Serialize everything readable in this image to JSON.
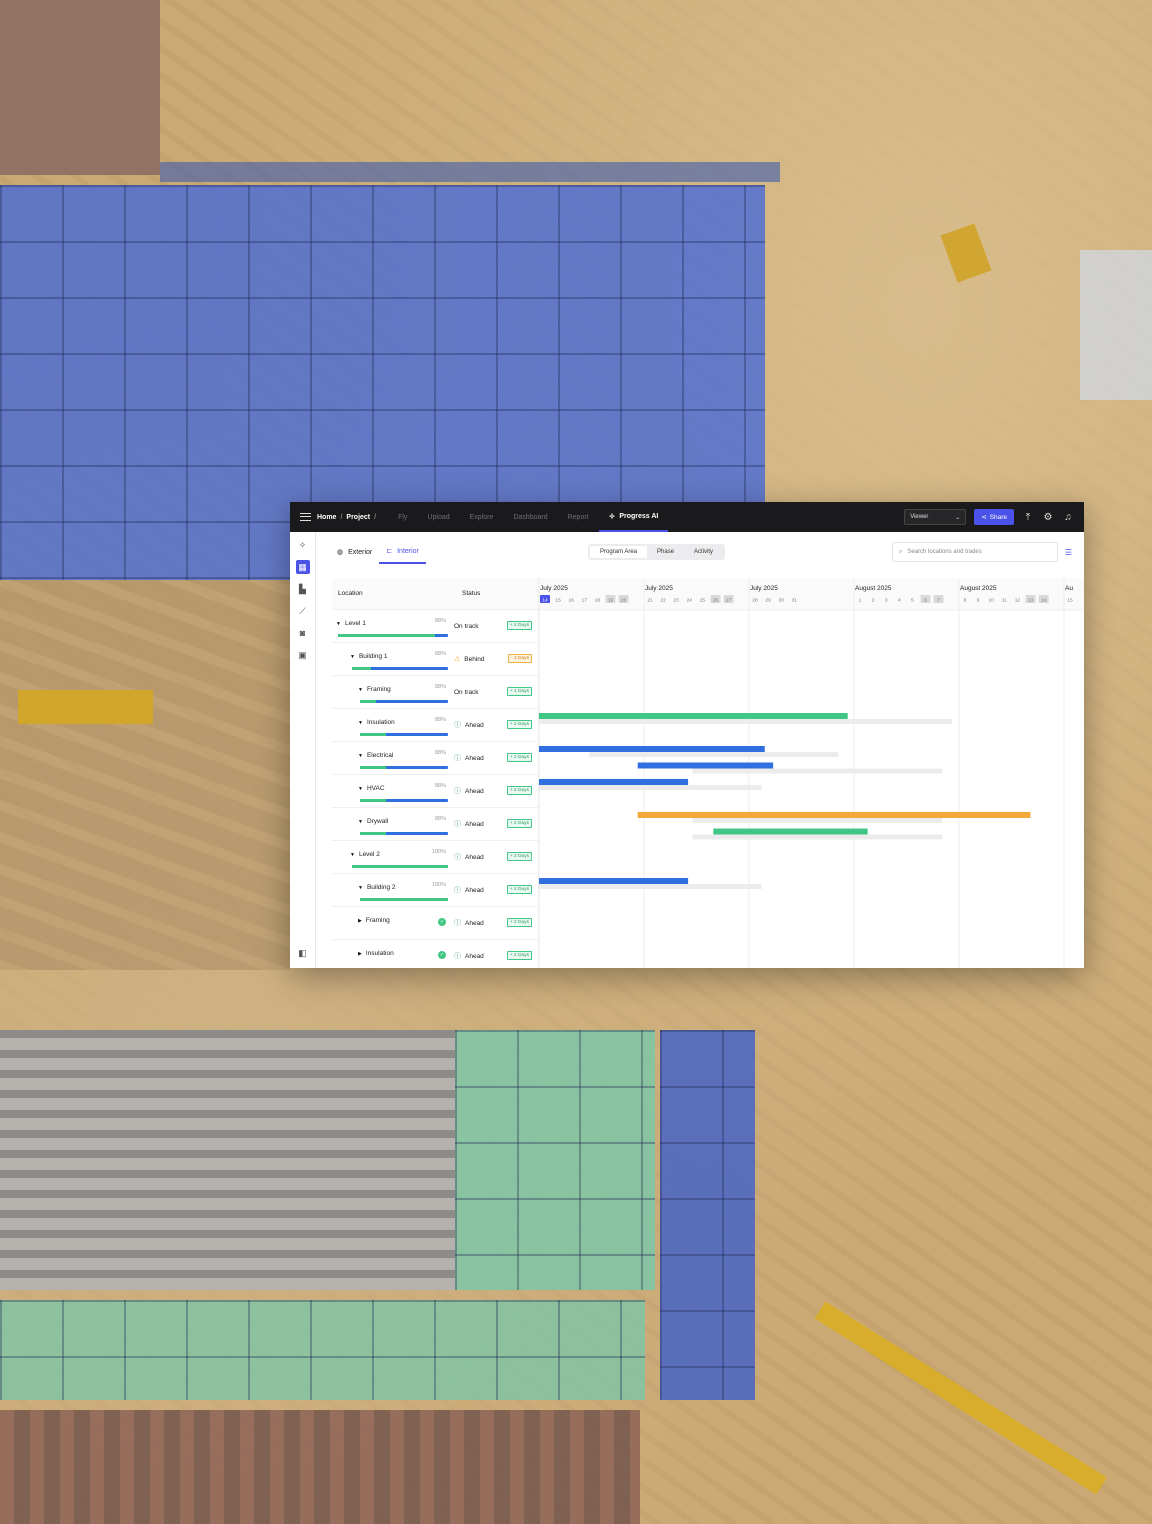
{
  "header": {
    "breadcrumb": [
      "Home",
      "Project"
    ],
    "nav": [
      "Fly",
      "Upload",
      "Explore",
      "Dashboard",
      "Report",
      "Progress AI"
    ],
    "active_nav": "Progress AI",
    "viewer_select": "Viewer",
    "share_label": "Share",
    "icons": [
      "menu-icon",
      "upload-icon",
      "settings-icon",
      "bell-icon"
    ]
  },
  "sidebar": {
    "icons": [
      "sparkle-icon",
      "grid-icon",
      "building-icon",
      "chart-icon",
      "camera-icon",
      "panorama-icon",
      "collapse-panel-icon"
    ]
  },
  "toolbar": {
    "tabs": [
      "Exterior",
      "Interior"
    ],
    "active_tab": "Interior",
    "segments": [
      "Program Area",
      "Phase",
      "Activity"
    ],
    "active_segment": "Program Area",
    "search_placeholder": "Search locations and trades"
  },
  "table": {
    "headers": {
      "location": "Location",
      "status": "Status"
    },
    "rows": [
      {
        "name": "Level 1",
        "indent": 0,
        "caret": "down",
        "pct": "88%",
        "progress": 0.88,
        "status": "On track",
        "status_icon": "",
        "delta": "+ 2 Days",
        "tone": "ok"
      },
      {
        "name": "Building 1",
        "indent": 1,
        "caret": "down",
        "pct": "88%",
        "progress": 0.2,
        "status": "Behind",
        "status_icon": "warn",
        "delta": "- 3 Days",
        "tone": "behind"
      },
      {
        "name": "Framing",
        "indent": 2,
        "caret": "down",
        "pct": "88%",
        "progress": 0.18,
        "status": "On track",
        "status_icon": "",
        "delta": "+ 1 Days",
        "tone": "ok"
      },
      {
        "name": "Insulation",
        "indent": 2,
        "caret": "down",
        "pct": "88%",
        "progress": 0.3,
        "status": "Ahead",
        "status_icon": "info",
        "delta": "+ 2 Days",
        "tone": "ok"
      },
      {
        "name": "Electrical",
        "indent": 2,
        "caret": "down",
        "pct": "88%",
        "progress": 0.3,
        "status": "Ahead",
        "status_icon": "info",
        "delta": "+ 2 Days",
        "tone": "ok"
      },
      {
        "name": "HVAC",
        "indent": 2,
        "caret": "down",
        "pct": "88%",
        "progress": 0.3,
        "status": "Ahead",
        "status_icon": "info",
        "delta": "+ 2 Days",
        "tone": "ok"
      },
      {
        "name": "Drywall",
        "indent": 2,
        "caret": "down",
        "pct": "88%",
        "progress": 0.3,
        "status": "Ahead",
        "status_icon": "info",
        "delta": "+ 2 Days",
        "tone": "ok"
      },
      {
        "name": "Level 2",
        "indent": 1,
        "caret": "down",
        "pct": "100%",
        "progress": 1.0,
        "status": "Ahead",
        "status_icon": "info",
        "delta": "+ 2 Days",
        "tone": "ok"
      },
      {
        "name": "Building 2",
        "indent": 2,
        "caret": "down",
        "pct": "100%",
        "progress": 1.0,
        "status": "Ahead",
        "status_icon": "info",
        "delta": "+ 2 Days",
        "tone": "ok"
      },
      {
        "name": "Framing",
        "indent": 2,
        "caret": "right",
        "pct": "",
        "progress": null,
        "status": "Ahead",
        "status_icon": "info",
        "delta": "+ 2 Days",
        "tone": "ok",
        "complete": true
      },
      {
        "name": "Insulation",
        "indent": 2,
        "caret": "right",
        "pct": "",
        "progress": null,
        "status": "Ahead",
        "status_icon": "info",
        "delta": "+ 2 Days",
        "tone": "ok",
        "complete": true
      }
    ]
  },
  "gantt": {
    "months": [
      {
        "label": "July 2025",
        "days": [
          "14",
          "15",
          "16",
          "17",
          "18",
          "19",
          "20"
        ],
        "weekend": [
          "19",
          "20"
        ],
        "today": "14"
      },
      {
        "label": "July 2025",
        "days": [
          "21",
          "22",
          "23",
          "24",
          "25",
          "26",
          "27"
        ],
        "weekend": [
          "26",
          "27"
        ]
      },
      {
        "label": "July 2025",
        "days": [
          "28",
          "29",
          "30",
          "31"
        ],
        "weekend": []
      },
      {
        "label": "August 2025",
        "days": [
          "1",
          "2",
          "3",
          "4",
          "5",
          "6",
          "7"
        ],
        "weekend": [
          "6",
          "7"
        ]
      },
      {
        "label": "August 2025",
        "days": [
          "8",
          "9",
          "10",
          "11",
          "12",
          "13",
          "14"
        ],
        "weekend": [
          "13",
          "14"
        ]
      },
      {
        "label": "Au",
        "days": [
          "15"
        ],
        "weekend": []
      }
    ],
    "colors": {
      "green": "#41c785",
      "blue": "#2f6fe0",
      "orange": "#f4a83a",
      "baseline": "#ececec",
      "accent": "#4b52e8"
    },
    "bars": [
      {
        "row": 3,
        "color": "green",
        "start": 0,
        "end": 2.94,
        "b_start": 0,
        "b_end": 3.93
      },
      {
        "row": 4,
        "color": "blue",
        "start": 0,
        "end": 2.15,
        "b_start": 0.48,
        "b_end": 2.85
      },
      {
        "row": 4.5,
        "color": "blue",
        "start": 0.94,
        "end": 2.23,
        "b_start": 1.46,
        "b_end": 3.84
      },
      {
        "row": 5,
        "color": "blue",
        "start": 0,
        "end": 1.42,
        "b_start": 0,
        "b_end": 2.12
      },
      {
        "row": 6,
        "color": "orange",
        "start": 0.94,
        "end": 4.68,
        "b_start": 1.46,
        "b_end": 3.84
      },
      {
        "row": 6.5,
        "color": "green",
        "start": 1.66,
        "end": 3.13,
        "b_start": 1.46,
        "b_end": 3.84
      },
      {
        "row": 8,
        "color": "blue",
        "start": 0,
        "end": 1.42,
        "b_start": 0,
        "b_end": 2.12
      }
    ]
  }
}
